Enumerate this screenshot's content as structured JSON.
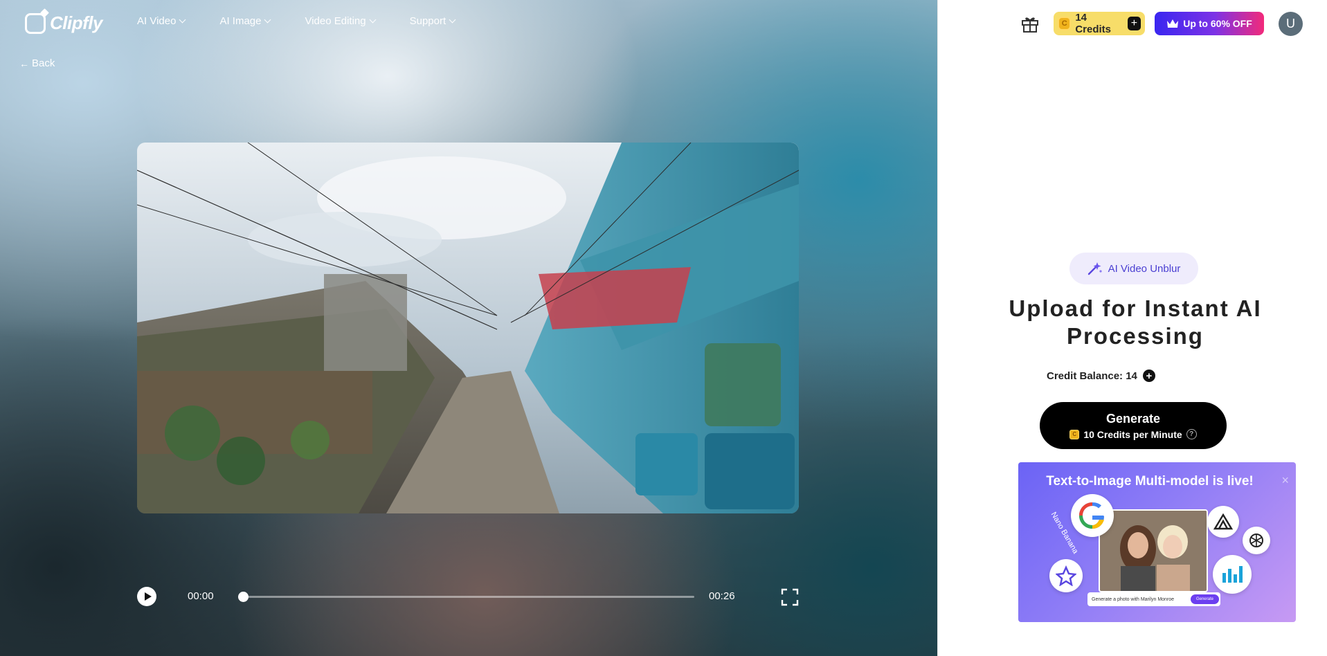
{
  "brand": {
    "name": "Clipfly"
  },
  "nav": {
    "items": [
      {
        "label": "AI Video"
      },
      {
        "label": "AI Image"
      },
      {
        "label": "Video Editing"
      },
      {
        "label": "Support"
      }
    ],
    "back_label": "Back"
  },
  "player": {
    "current_time": "00:00",
    "total_time": "00:26",
    "progress": 0.0
  },
  "topbar": {
    "credits_label": "14 Credits",
    "coin_glyph": "C",
    "offer_label": "Up to 60% OFF",
    "avatar_initial": "U"
  },
  "panel": {
    "tool_badge": "AI Video Unblur",
    "headline": "Upload for Instant AI Processing",
    "credit_balance_label": "Credit Balance: 14",
    "generate": {
      "title": "Generate",
      "cost": "10 Credits per Minute",
      "coin_glyph": "C",
      "help_glyph": "?"
    }
  },
  "promo": {
    "title": "Text-to-Image Multi-model is live!",
    "close_glyph": "×",
    "nano_label": "Nano Banana",
    "prompt_text": "Generate a photo with Marilyn Monroe",
    "prompt_button": "Generate"
  },
  "colors": {
    "accent": "#4a3fd2",
    "credits_bg": "#f7dd69",
    "offer_start": "#3a26f0",
    "offer_end": "#f22a7a"
  }
}
